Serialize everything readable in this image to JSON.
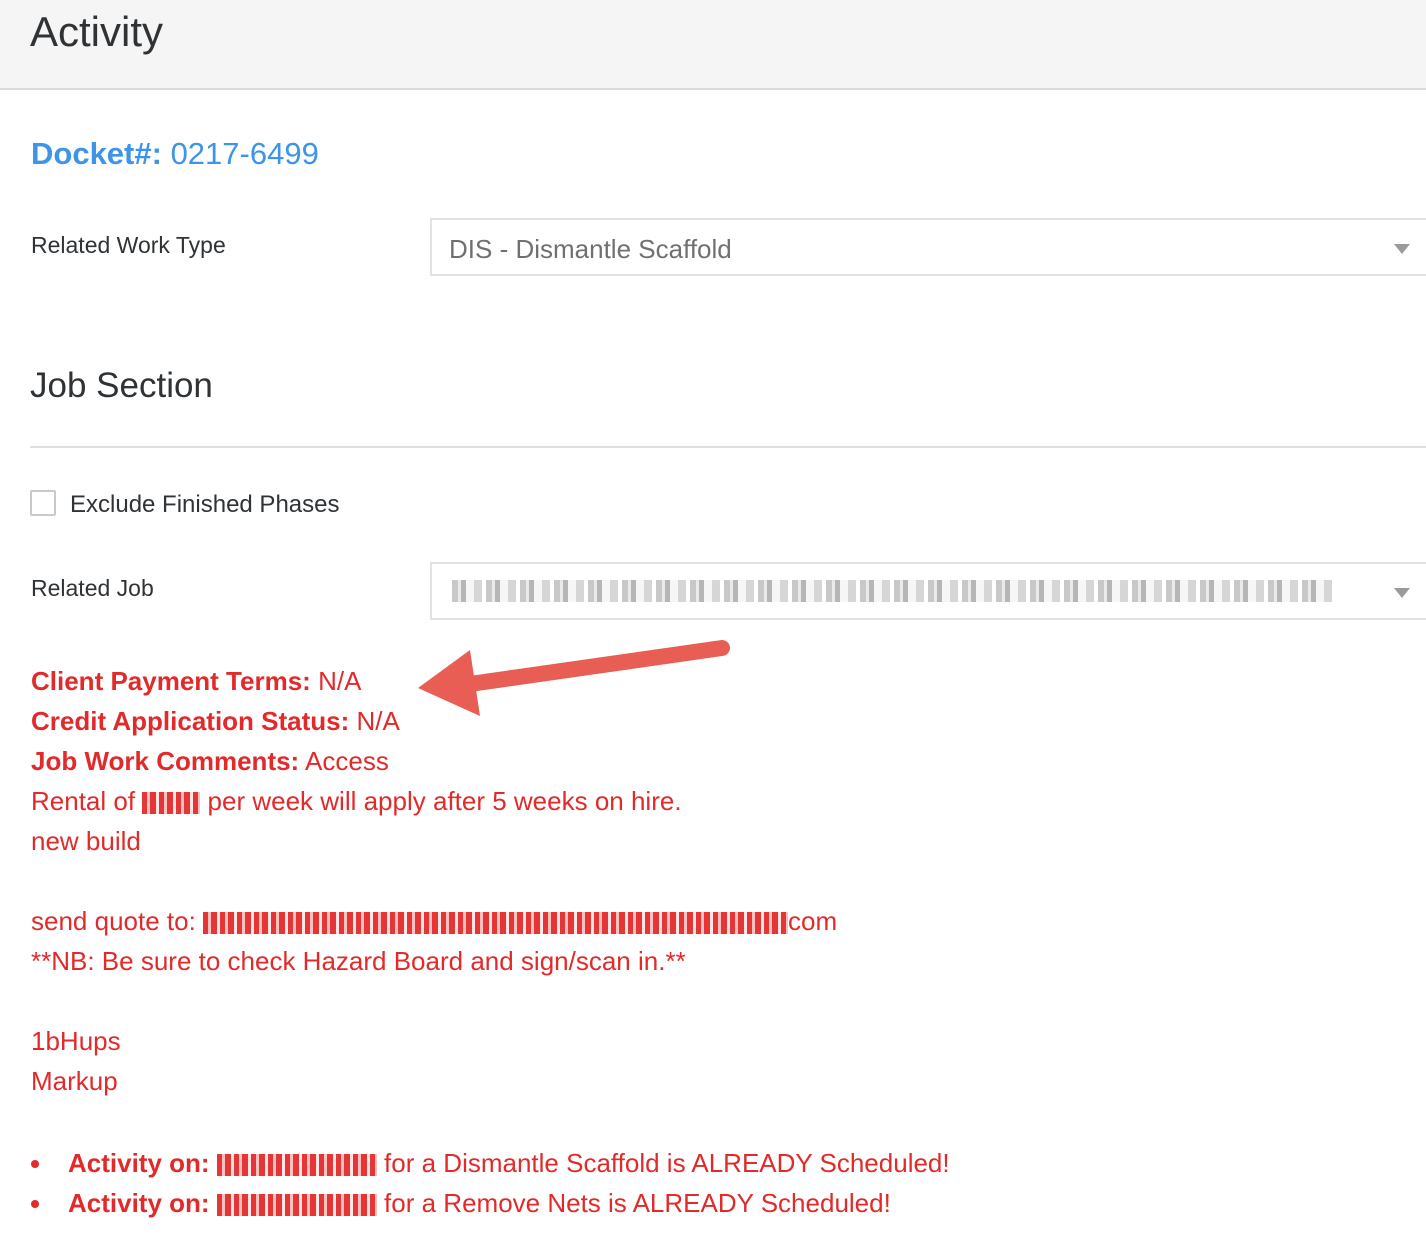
{
  "header": {
    "title": "Activity"
  },
  "docket": {
    "label": "Docket#:",
    "number": "0217-6499"
  },
  "work_type": {
    "label": "Related Work Type",
    "value": "DIS - Dismantle Scaffold"
  },
  "job_section": {
    "title": "Job Section",
    "exclude_label": "Exclude Finished Phases",
    "related_job_label": "Related Job"
  },
  "info": {
    "payment_label": "Client Payment Terms:",
    "payment_value": "N/A",
    "credit_label": "Credit Application Status:",
    "credit_value": "N/A",
    "comments_label": "Job Work Comments:",
    "comments_value": "Access",
    "rental_prefix": "Rental of",
    "rental_suffix": "per week will apply after 5 weeks on hire.",
    "line_new_build": "new build",
    "send_quote_prefix": "send quote to:",
    "send_quote_suffix": "com",
    "nb_line": "**NB: Be sure to check Hazard Board and sign/scan in.**",
    "line_hups": "1bHups",
    "line_markup": "Markup"
  },
  "scheduled": [
    {
      "label": "Activity on:",
      "text": "for a Dismantle Scaffold is ALREADY Scheduled!"
    },
    {
      "label": "Activity on:",
      "text": "for a Remove Nets is ALREADY Scheduled!"
    }
  ],
  "colors": {
    "accent_blue": "#3d94e8",
    "alert_red": "#e22a2a",
    "arrow": "#e85d54"
  }
}
